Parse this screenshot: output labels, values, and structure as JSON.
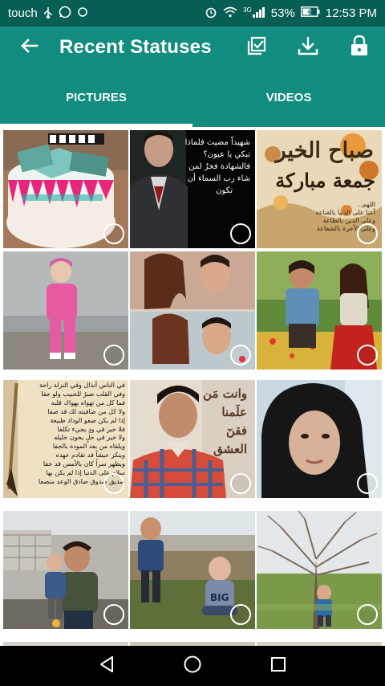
{
  "status_bar": {
    "carrier": "touch",
    "battery": "53%",
    "time": "12:53 PM",
    "network": "3G",
    "icons": [
      "usb-icon",
      "whatsapp-icon",
      "message-icon",
      "alarm-icon",
      "wifi-icon",
      "signal-icon",
      "battery-icon"
    ]
  },
  "app_bar": {
    "title": "Recent Statuses",
    "icons": [
      "back-arrow-icon",
      "select-all-icon",
      "download-icon",
      "lock-icon"
    ]
  },
  "tabs": [
    {
      "label": "PICTURES",
      "active": true
    },
    {
      "label": "VIDEOS",
      "active": false
    }
  ],
  "grid": {
    "tiles": [
      {
        "name": "cake-photo"
      },
      {
        "name": "portrait-with-arabic-text",
        "text_lines": [
          "شهيداً مضيت فلماذا",
          "تبكي يا عيون؟",
          "فالشهادة فخرٌ لمن",
          "شاء رب السماء أن",
          "تكون"
        ]
      },
      {
        "name": "friday-greeting-card",
        "heading": "صباح الخير",
        "subheading": "جمعة مباركة",
        "small_lines": [
          "اللهم..",
          "أعنا على الدنيا بالقناعة",
          "وعلى الدين بالطاعة",
          "وعلى الأخرة بالشفاعة"
        ]
      },
      {
        "name": "child-photo"
      },
      {
        "name": "couple-collage"
      },
      {
        "name": "couple-in-field"
      },
      {
        "name": "arabic-quote-card",
        "text_lines": [
          "في الناس أنذال وفي النزلة راحة",
          "وفي القلب صبرٌ للحبيب ولو جفا",
          "فما كل من تهواه يهواك قلبه",
          "ولا كل من صافيته لك قد صفا",
          "إذا لم يكن صفو الوداد طبيعة",
          "فلا خير في ودٍ يجيء تكلفا",
          "ولا خير في خلٍ يخون خليله",
          "ويلقاه من بعد المودة بالجفا",
          "وينكر عيشاً قد تقادم عهده",
          "ويظهر سراً كان بالأمس قد خفا",
          "سلام على الدنيا إذا لم يكن بها",
          "صديق صدوق صادق الوعد منصفا"
        ]
      },
      {
        "name": "young-man-with-text",
        "text_lines": [
          "وانت مَن",
          "علَمنا",
          "فقنٓ",
          "العشق"
        ]
      },
      {
        "name": "woman-in-hijab"
      },
      {
        "name": "man-with-child"
      },
      {
        "name": "two-children-outdoors"
      },
      {
        "name": "child-under-tree"
      }
    ]
  },
  "nav_bar": {
    "icons": [
      "nav-back-icon",
      "nav-home-icon",
      "nav-recents-icon"
    ]
  },
  "colors": {
    "status_bar": "#075e54",
    "app_bar": "#128c7e",
    "indicator": "#ffffff"
  }
}
